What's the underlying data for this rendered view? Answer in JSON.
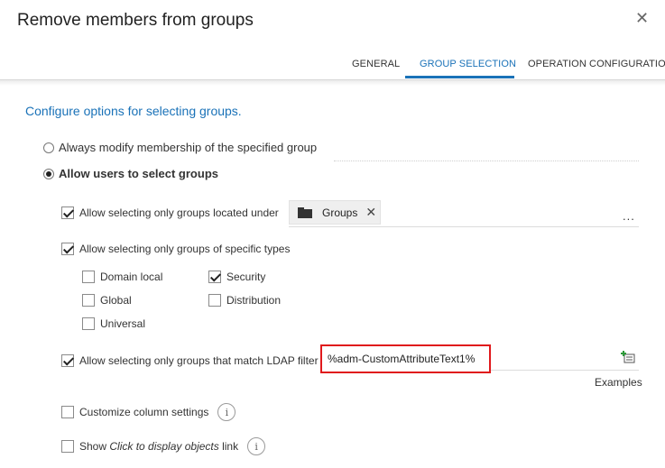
{
  "dialog": {
    "title": "Remove members from groups",
    "close_glyph": "✕"
  },
  "tabs": [
    {
      "label": "GENERAL",
      "active": false
    },
    {
      "label": "GROUP SELECTION",
      "active": true
    },
    {
      "label": "OPERATION CONFIGURATION",
      "active": false
    }
  ],
  "main": {
    "subtitle": "Configure options for selecting groups.",
    "radio_options": [
      {
        "label": "Always modify membership of the specified group",
        "checked": false
      },
      {
        "label": "Allow users to select groups",
        "checked": true
      }
    ],
    "located_under": {
      "label": "Allow selecting only groups located under",
      "checked": true,
      "chip_label": "Groups",
      "chip_remove_glyph": "✕",
      "more_glyph": "..."
    },
    "specific_types": {
      "label": "Allow selecting only groups of specific types",
      "checked": true,
      "types": [
        {
          "label": "Domain local",
          "checked": false
        },
        {
          "label": "Security",
          "checked": true
        },
        {
          "label": "Global",
          "checked": false
        },
        {
          "label": "Distribution",
          "checked": false
        },
        {
          "label": "Universal",
          "checked": false
        }
      ]
    },
    "ldap": {
      "label": "Allow selecting only groups that match LDAP filter",
      "checked": true,
      "value": "%adm-CustomAttributeText1%",
      "examples_label": "Examples"
    },
    "customize_columns": {
      "label": "Customize column settings",
      "checked": false,
      "info_glyph": "i"
    },
    "show_click": {
      "prefix": "Show ",
      "italic": "Click to display objects",
      "suffix": " link",
      "checked": false,
      "info_glyph": "i"
    }
  },
  "colors": {
    "accent": "#1a72b8",
    "highlight_border": "#e0191c"
  }
}
